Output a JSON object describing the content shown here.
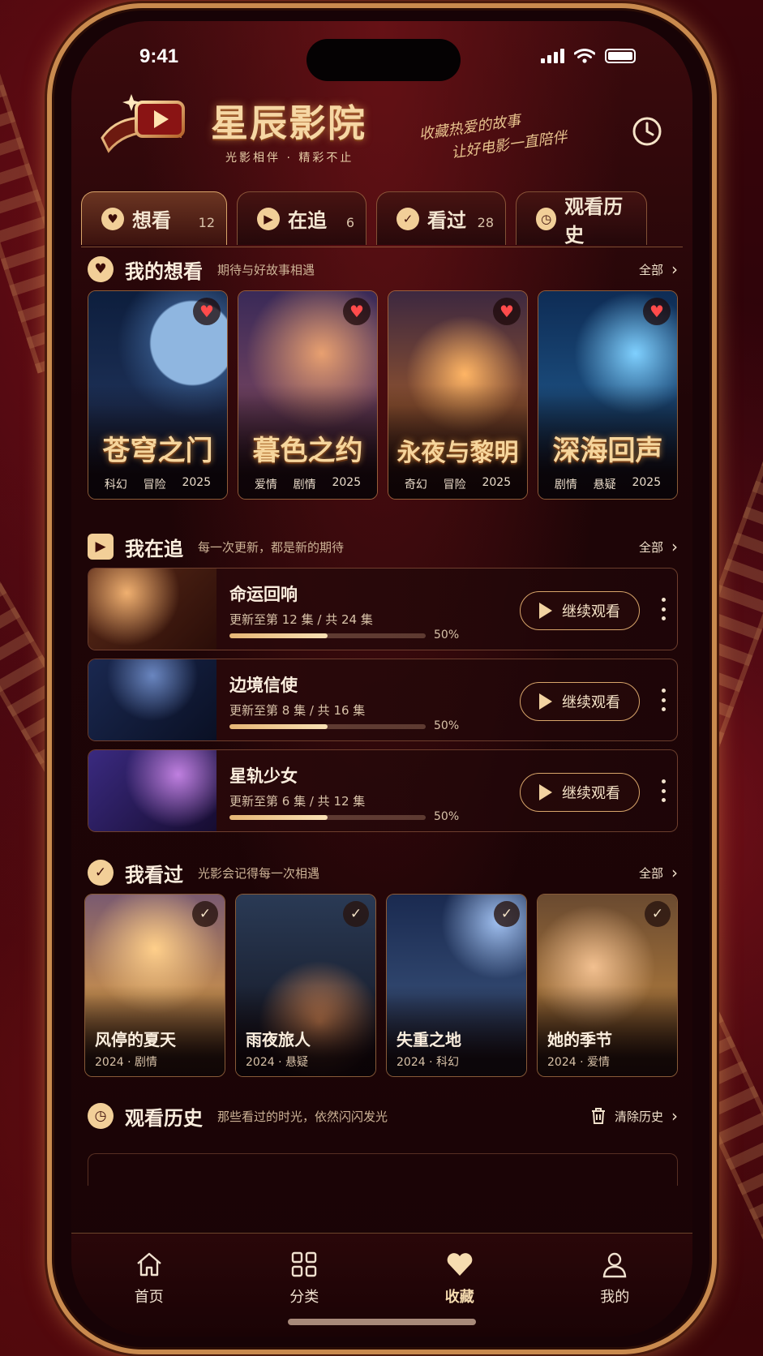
{
  "status": {
    "time": "9:41"
  },
  "brand": {
    "title": "星辰影院",
    "subtitle": "光影相伴 · 精彩不止",
    "slogan_line1": "收藏热爱的故事",
    "slogan_line2": "让好电影一直陪伴"
  },
  "tabs": [
    {
      "label": "想看",
      "count": "12",
      "icon": "heart-icon",
      "active": true
    },
    {
      "label": "在追",
      "count": "6",
      "icon": "play-icon"
    },
    {
      "label": "看过",
      "count": "28",
      "icon": "check-icon"
    },
    {
      "label": "观看历史",
      "count": "",
      "icon": "clock-icon"
    }
  ],
  "want_section": {
    "title": "我的想看",
    "subtitle": "期待与好故事相遇",
    "more": "全部",
    "items": [
      {
        "title": "苍穹之门",
        "genre1": "科幻",
        "genre2": "冒险",
        "year": "2025"
      },
      {
        "title": "暮色之约",
        "genre1": "爱情",
        "genre2": "剧情",
        "year": "2025"
      },
      {
        "title": "永夜与黎明",
        "genre1": "奇幻",
        "genre2": "冒险",
        "year": "2025"
      },
      {
        "title": "深海回声",
        "genre1": "剧情",
        "genre2": "悬疑",
        "year": "2025"
      }
    ]
  },
  "watching_section": {
    "title": "我在追",
    "subtitle": "每一次更新，都是新的期待",
    "more": "全部",
    "items": [
      {
        "title": "命运回响",
        "episodes": "更新至第 12 集 / 共 24 集",
        "progress_pct": "50%",
        "progress": 0.5,
        "button": "继续观看"
      },
      {
        "title": "边境信使",
        "episodes": "更新至第 8 集 / 共 16 集",
        "progress_pct": "50%",
        "progress": 0.5,
        "button": "继续观看"
      },
      {
        "title": "星轨少女",
        "episodes": "更新至第 6 集 / 共 12 集",
        "progress_pct": "50%",
        "progress": 0.5,
        "button": "继续观看"
      }
    ]
  },
  "watched_section": {
    "title": "我看过",
    "subtitle": "光影会记得每一次相遇",
    "more": "全部",
    "items": [
      {
        "title": "风停的夏天",
        "meta": "2024 · 剧情"
      },
      {
        "title": "雨夜旅人",
        "meta": "2024 · 悬疑"
      },
      {
        "title": "失重之地",
        "meta": "2024 · 科幻"
      },
      {
        "title": "她的季节",
        "meta": "2024 · 爱情"
      }
    ]
  },
  "history_section": {
    "title": "观看历史",
    "subtitle": "那些看过的时光，依然闪闪发光",
    "clear": "清除历史"
  },
  "tabbar": [
    {
      "label": "首页",
      "icon": "home-icon"
    },
    {
      "label": "分类",
      "icon": "grid-icon"
    },
    {
      "label": "收藏",
      "icon": "heart-icon",
      "active": true
    },
    {
      "label": "我的",
      "icon": "user-icon"
    }
  ],
  "colors": {
    "accent": "#f2cf98",
    "background": "#1f0507",
    "heart": "#ff4b4b"
  }
}
